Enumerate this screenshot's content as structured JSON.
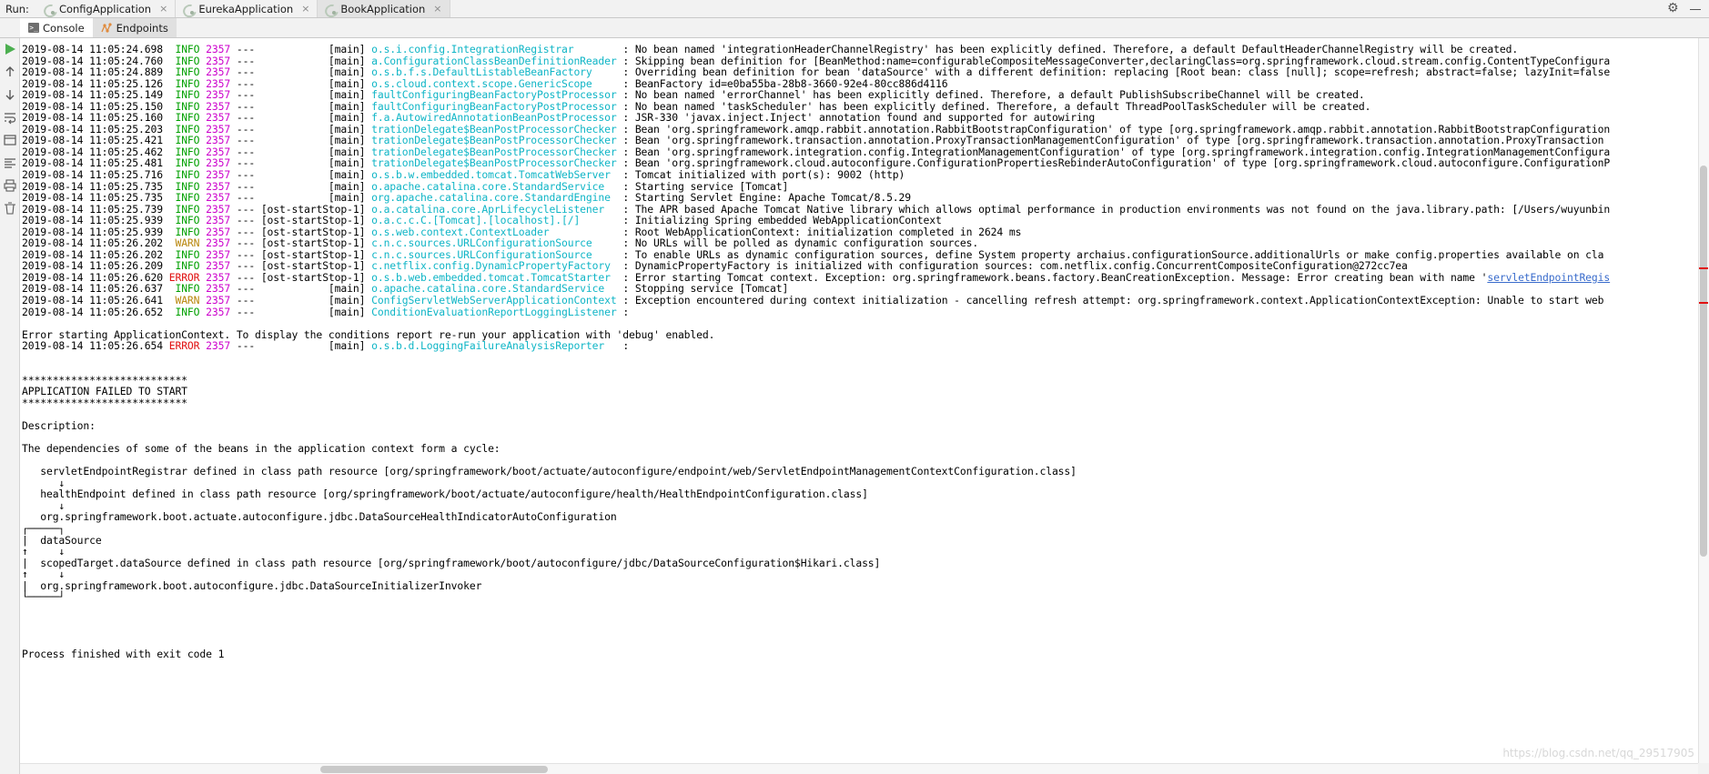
{
  "window": {
    "run_label": "Run:",
    "settings_icon": "gear-icon",
    "minimize_icon": "minimize-icon"
  },
  "app_tabs": [
    {
      "label": "ConfigApplication",
      "icon": "spring-boot-icon",
      "close": "×",
      "active": false
    },
    {
      "label": "EurekaApplication",
      "icon": "spring-boot-icon",
      "close": "×",
      "active": false
    },
    {
      "label": "BookApplication",
      "icon": "spring-boot-icon",
      "close": "×",
      "active": true
    }
  ],
  "tool_tabs": [
    {
      "label": "Console",
      "icon": "console-icon",
      "active": true
    },
    {
      "label": "Endpoints",
      "icon": "endpoints-icon",
      "active": false
    }
  ],
  "gutter_icons": [
    "rerun-icon",
    "scroll-up-icon",
    "scroll-down-icon",
    "wrap-text-icon",
    "soft-wrap-icon",
    "print-icon",
    "clear-all-icon",
    "pin-icon"
  ],
  "scrollbars": {
    "vertical_thumb": "vertical-scrollbar-thumb",
    "horizontal_thumb": "horizontal-scrollbar-thumb"
  },
  "watermark": "https://blog.csdn.net/qq_29517905",
  "console": {
    "lines": [
      {
        "ts": "2019-08-14 11:05:24.698",
        "lvl": "INFO",
        "pid": "2357",
        "thread": "main",
        "logger": "o.s.i.config.IntegrationRegistrar",
        "msg": "No bean named 'integrationHeaderChannelRegistry' has been explicitly defined. Therefore, a default DefaultHeaderChannelRegistry will be created."
      },
      {
        "ts": "2019-08-14 11:05:24.760",
        "lvl": "INFO",
        "pid": "2357",
        "thread": "main",
        "logger": "a.ConfigurationClassBeanDefinitionReader",
        "msg": "Skipping bean definition for [BeanMethod:name=configurableCompositeMessageConverter,declaringClass=org.springframework.cloud.stream.config.ContentTypeConfigura"
      },
      {
        "ts": "2019-08-14 11:05:24.889",
        "lvl": "INFO",
        "pid": "2357",
        "thread": "main",
        "logger": "o.s.b.f.s.DefaultListableBeanFactory",
        "msg": "Overriding bean definition for bean 'dataSource' with a different definition: replacing [Root bean: class [null]; scope=refresh; abstract=false; lazyInit=false"
      },
      {
        "ts": "2019-08-14 11:05:25.126",
        "lvl": "INFO",
        "pid": "2357",
        "thread": "main",
        "logger": "o.s.cloud.context.scope.GenericScope",
        "msg": "BeanFactory id=e0ba55ba-28b8-3660-92e4-80cc886d4116"
      },
      {
        "ts": "2019-08-14 11:05:25.149",
        "lvl": "INFO",
        "pid": "2357",
        "thread": "main",
        "logger": "faultConfiguringBeanFactoryPostProcessor",
        "msg": "No bean named 'errorChannel' has been explicitly defined. Therefore, a default PublishSubscribeChannel will be created."
      },
      {
        "ts": "2019-08-14 11:05:25.150",
        "lvl": "INFO",
        "pid": "2357",
        "thread": "main",
        "logger": "faultConfiguringBeanFactoryPostProcessor",
        "msg": "No bean named 'taskScheduler' has been explicitly defined. Therefore, a default ThreadPoolTaskScheduler will be created."
      },
      {
        "ts": "2019-08-14 11:05:25.160",
        "lvl": "INFO",
        "pid": "2357",
        "thread": "main",
        "logger": "f.a.AutowiredAnnotationBeanPostProcessor",
        "msg": "JSR-330 'javax.inject.Inject' annotation found and supported for autowiring"
      },
      {
        "ts": "2019-08-14 11:05:25.203",
        "lvl": "INFO",
        "pid": "2357",
        "thread": "main",
        "logger": "trationDelegate$BeanPostProcessorChecker",
        "msg": "Bean 'org.springframework.amqp.rabbit.annotation.RabbitBootstrapConfiguration' of type [org.springframework.amqp.rabbit.annotation.RabbitBootstrapConfiguration"
      },
      {
        "ts": "2019-08-14 11:05:25.421",
        "lvl": "INFO",
        "pid": "2357",
        "thread": "main",
        "logger": "trationDelegate$BeanPostProcessorChecker",
        "msg": "Bean 'org.springframework.transaction.annotation.ProxyTransactionManagementConfiguration' of type [org.springframework.transaction.annotation.ProxyTransaction"
      },
      {
        "ts": "2019-08-14 11:05:25.462",
        "lvl": "INFO",
        "pid": "2357",
        "thread": "main",
        "logger": "trationDelegate$BeanPostProcessorChecker",
        "msg": "Bean 'org.springframework.integration.config.IntegrationManagementConfiguration' of type [org.springframework.integration.config.IntegrationManagementConfigura"
      },
      {
        "ts": "2019-08-14 11:05:25.481",
        "lvl": "INFO",
        "pid": "2357",
        "thread": "main",
        "logger": "trationDelegate$BeanPostProcessorChecker",
        "msg": "Bean 'org.springframework.cloud.autoconfigure.ConfigurationPropertiesRebinderAutoConfiguration' of type [org.springframework.cloud.autoconfigure.ConfigurationP"
      },
      {
        "ts": "2019-08-14 11:05:25.716",
        "lvl": "INFO",
        "pid": "2357",
        "thread": "main",
        "logger": "o.s.b.w.embedded.tomcat.TomcatWebServer",
        "msg": "Tomcat initialized with port(s): 9002 (http)"
      },
      {
        "ts": "2019-08-14 11:05:25.735",
        "lvl": "INFO",
        "pid": "2357",
        "thread": "main",
        "logger": "o.apache.catalina.core.StandardService",
        "msg": "Starting service [Tomcat]"
      },
      {
        "ts": "2019-08-14 11:05:25.735",
        "lvl": "INFO",
        "pid": "2357",
        "thread": "main",
        "logger": "org.apache.catalina.core.StandardEngine",
        "msg": "Starting Servlet Engine: Apache Tomcat/8.5.29"
      },
      {
        "ts": "2019-08-14 11:05:25.739",
        "lvl": "INFO",
        "pid": "2357",
        "thread": "ost-startStop-1",
        "logger": "o.a.catalina.core.AprLifecycleListener",
        "msg": "The APR based Apache Tomcat Native library which allows optimal performance in production environments was not found on the java.library.path: [/Users/wuyunbin"
      },
      {
        "ts": "2019-08-14 11:05:25.939",
        "lvl": "INFO",
        "pid": "2357",
        "thread": "ost-startStop-1",
        "logger": "o.a.c.c.C.[Tomcat].[localhost].[/]",
        "msg": "Initializing Spring embedded WebApplicationContext"
      },
      {
        "ts": "2019-08-14 11:05:25.939",
        "lvl": "INFO",
        "pid": "2357",
        "thread": "ost-startStop-1",
        "logger": "o.s.web.context.ContextLoader",
        "msg": "Root WebApplicationContext: initialization completed in 2624 ms"
      },
      {
        "ts": "2019-08-14 11:05:26.202",
        "lvl": "WARN",
        "pid": "2357",
        "thread": "ost-startStop-1",
        "logger": "c.n.c.sources.URLConfigurationSource",
        "msg": "No URLs will be polled as dynamic configuration sources."
      },
      {
        "ts": "2019-08-14 11:05:26.202",
        "lvl": "INFO",
        "pid": "2357",
        "thread": "ost-startStop-1",
        "logger": "c.n.c.sources.URLConfigurationSource",
        "msg": "To enable URLs as dynamic configuration sources, define System property archaius.configurationSource.additionalUrls or make config.properties available on cla"
      },
      {
        "ts": "2019-08-14 11:05:26.209",
        "lvl": "INFO",
        "pid": "2357",
        "thread": "ost-startStop-1",
        "logger": "c.netflix.config.DynamicPropertyFactory",
        "msg": "DynamicPropertyFactory is initialized with configuration sources: com.netflix.config.ConcurrentCompositeConfiguration@272cc7ea"
      },
      {
        "ts": "2019-08-14 11:05:26.620",
        "lvl": "ERROR",
        "pid": "2357",
        "thread": "ost-startStop-1",
        "logger": "o.s.b.web.embedded.tomcat.TomcatStarter",
        "msg": "Error starting Tomcat context. Exception: org.springframework.beans.factory.BeanCreationException. Message: Error creating bean with name '",
        "link": "servletEndpointRegis"
      },
      {
        "ts": "2019-08-14 11:05:26.637",
        "lvl": "INFO",
        "pid": "2357",
        "thread": "main",
        "logger": "o.apache.catalina.core.StandardService",
        "msg": "Stopping service [Tomcat]"
      },
      {
        "ts": "2019-08-14 11:05:26.641",
        "lvl": "WARN",
        "pid": "2357",
        "thread": "main",
        "logger": "ConfigServletWebServerApplicationContext",
        "msg": "Exception encountered during context initialization - cancelling refresh attempt: org.springframework.context.ApplicationContextException: Unable to start web"
      },
      {
        "ts": "2019-08-14 11:05:26.652",
        "lvl": "INFO",
        "pid": "2357",
        "thread": "main",
        "logger": "ConditionEvaluationReportLoggingListener",
        "msg": ""
      }
    ],
    "plain_block_1": [
      "",
      "Error starting ApplicationContext. To display the conditions report re-run your application with 'debug' enabled."
    ],
    "reporter_line": {
      "ts": "2019-08-14 11:05:26.654",
      "lvl": "ERROR",
      "pid": "2357",
      "thread": "main",
      "logger": "o.s.b.d.LoggingFailureAnalysisReporter",
      "msg": ""
    },
    "failure_block": [
      "",
      "",
      "***************************",
      "APPLICATION FAILED TO START",
      "***************************",
      "",
      "Description:",
      "",
      "The dependencies of some of the beans in the application context form a cycle:",
      "",
      "   servletEndpointRegistrar defined in class path resource [org/springframework/boot/actuate/autoconfigure/endpoint/web/ServletEndpointManagementContextConfiguration.class]",
      "      ↓",
      "   healthEndpoint defined in class path resource [org/springframework/boot/actuate/autoconfigure/health/HealthEndpointConfiguration.class]",
      "      ↓",
      "   org.springframework.boot.actuate.autoconfigure.jdbc.DataSourceHealthIndicatorAutoConfiguration",
      "┌─────┐",
      "|  dataSource",
      "↑     ↓",
      "|  scopedTarget.dataSource defined in class path resource [org/springframework/boot/autoconfigure/jdbc/DataSourceConfiguration$Hikari.class]",
      "↑     ↓",
      "|  org.springframework.boot.autoconfigure.jdbc.DataSourceInitializerInvoker",
      "└─────┘",
      "",
      "",
      "",
      "",
      "Process finished with exit code 1"
    ]
  }
}
